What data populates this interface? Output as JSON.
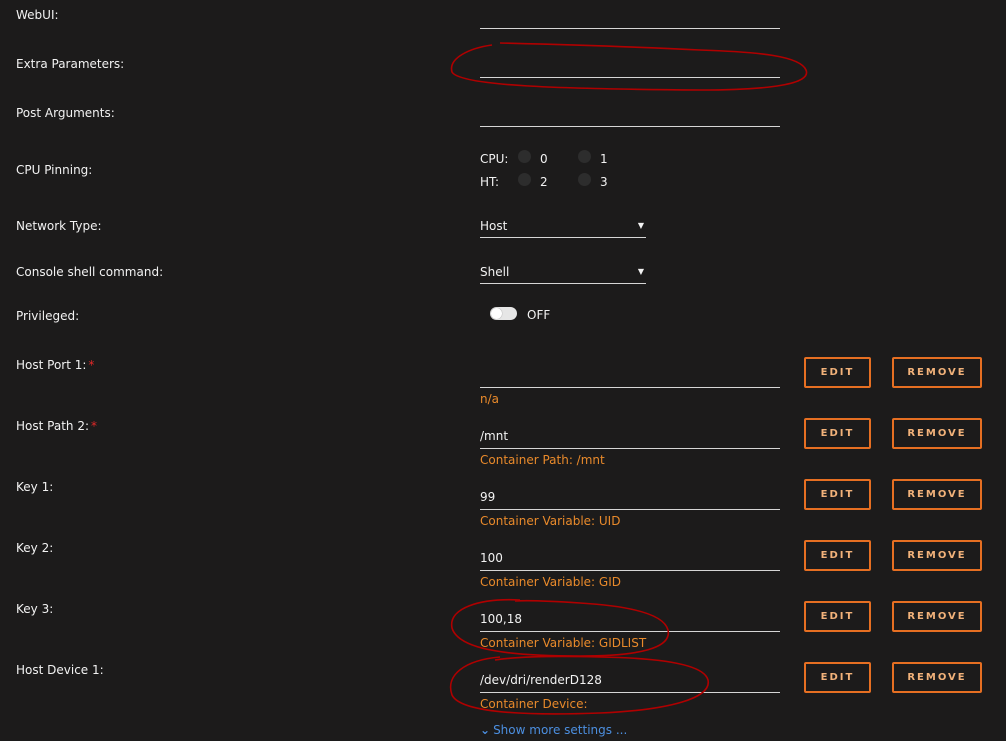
{
  "labels": {
    "webui": "WebUI:",
    "extra_parameters": "Extra Parameters:",
    "post_arguments": "Post Arguments:",
    "cpu_pinning": "CPU Pinning:",
    "network_type": "Network Type:",
    "console_shell": "Console shell command:",
    "privileged": "Privileged:",
    "host_port_1": "Host Port 1:",
    "host_path_2": "Host Path 2:",
    "key_1": "Key 1:",
    "key_2": "Key 2:",
    "key_3": "Key 3:",
    "host_device_1": "Host Device 1:",
    "required_mark": "*"
  },
  "cpu": {
    "cpu_label": "CPU:",
    "ht_label": "HT:",
    "cores": [
      "0",
      "1"
    ],
    "threads": [
      "2",
      "3"
    ]
  },
  "network_type": {
    "value": "Host"
  },
  "console_shell": {
    "value": "Shell"
  },
  "privileged": {
    "state": "OFF"
  },
  "mappings": [
    {
      "value": "",
      "sub": "n/a"
    },
    {
      "value": "/mnt",
      "sub": "Container Path: /mnt"
    },
    {
      "value": "99",
      "sub": "Container Variable: UID"
    },
    {
      "value": "100",
      "sub": "Container Variable: GID"
    },
    {
      "value": "100,18",
      "sub": "Container Variable: GIDLIST"
    },
    {
      "value": "/dev/dri/renderD128",
      "sub": "Container Device:"
    }
  ],
  "buttons": {
    "edit": "EDIT",
    "remove": "REMOVE"
  },
  "show_more": "Show more settings ...",
  "colors": {
    "background": "#1c1b1b",
    "accent_orange": "#e66f22",
    "sub_text": "#e98a2b",
    "link": "#4c8fe0",
    "annotation": "#b00000"
  }
}
